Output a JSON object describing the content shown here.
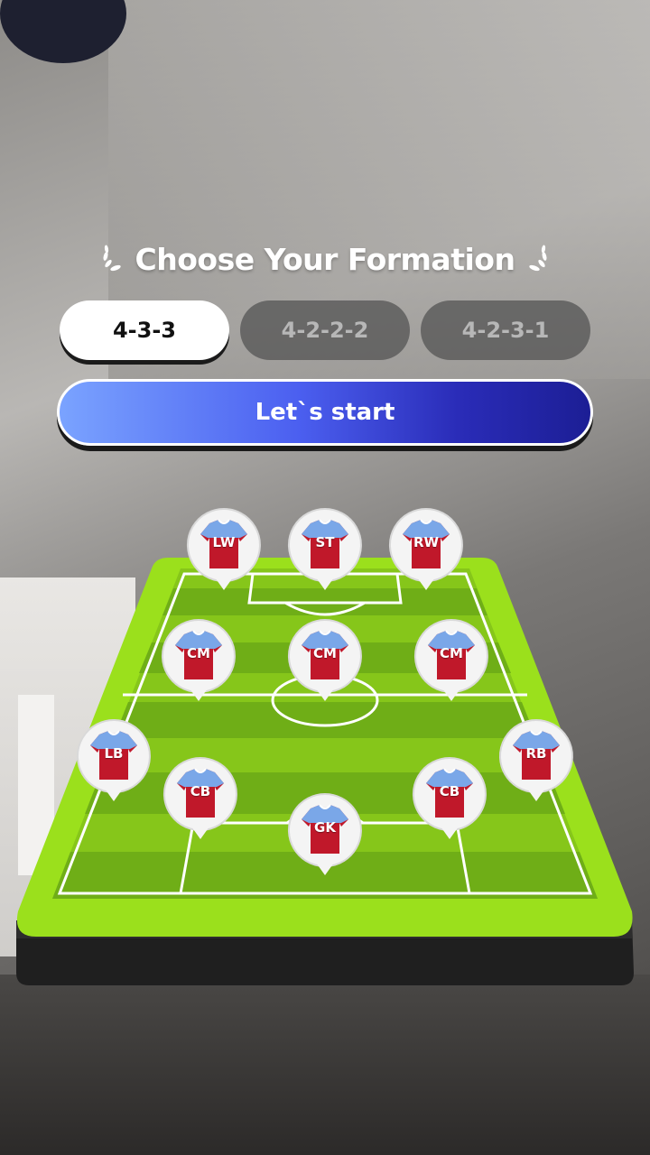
{
  "title": {
    "text": "Choose Your Formation",
    "left_icon": "laurel-icon",
    "right_icon": "laurel-icon"
  },
  "formations": [
    {
      "label": "4-3-3",
      "selected": true
    },
    {
      "label": "4-2-2-2",
      "selected": false
    },
    {
      "label": "4-2-3-1",
      "selected": false
    }
  ],
  "start_button": {
    "label": "Let`s start"
  },
  "pitch": {
    "players": [
      {
        "position": "LW",
        "name": "player-lw"
      },
      {
        "position": "ST",
        "name": "player-st"
      },
      {
        "position": "RW",
        "name": "player-rw"
      },
      {
        "position": "CM",
        "name": "player-cm-left"
      },
      {
        "position": "CM",
        "name": "player-cm-center"
      },
      {
        "position": "CM",
        "name": "player-cm-right"
      },
      {
        "position": "LB",
        "name": "player-lb"
      },
      {
        "position": "RB",
        "name": "player-rb"
      },
      {
        "position": "CB",
        "name": "player-cb-left"
      },
      {
        "position": "CB",
        "name": "player-cb-right"
      },
      {
        "position": "GK",
        "name": "player-gk"
      }
    ]
  },
  "colors": {
    "pitch_green": "#8fd61a",
    "pitch_stripe": "#6fb418",
    "jersey_red": "#c0182a",
    "jersey_blue": "#7aa7e8",
    "button_gradient_start": "#7aa3ff",
    "button_gradient_end": "#1c1e95"
  }
}
